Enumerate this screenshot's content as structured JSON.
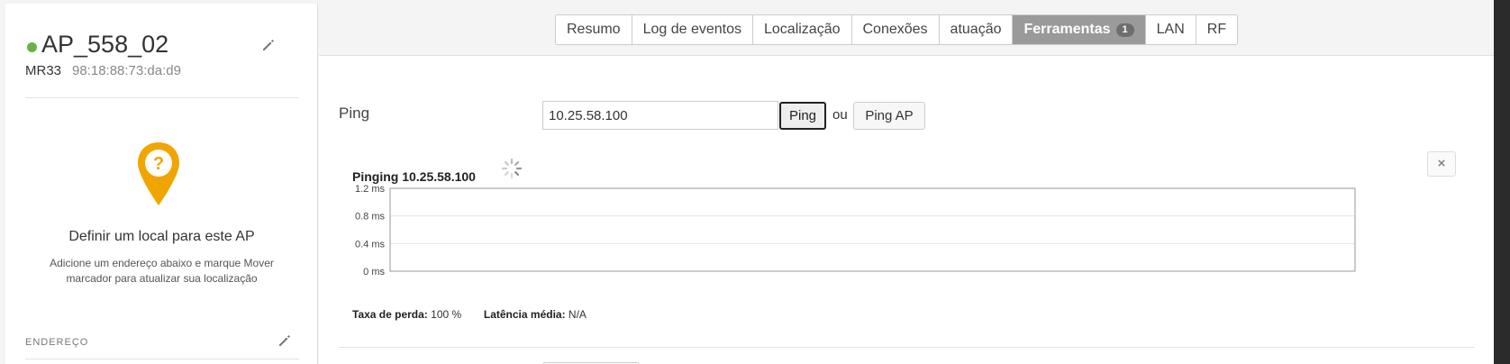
{
  "sidebar": {
    "ap_name": "AP_558_02",
    "status_color": "#67b346",
    "model": "MR33",
    "mac": "98:18:88:73:da:d9",
    "location_title": "Definir um local para este AP",
    "location_subtitle": "Adicione um endereço abaixo e marque Mover marcador para atualizar sua localização",
    "address_label": "ENDEREÇO"
  },
  "tabs": [
    {
      "label": "Resumo"
    },
    {
      "label": "Log de eventos"
    },
    {
      "label": "Localização"
    },
    {
      "label": "Conexões"
    },
    {
      "label": "atuação"
    },
    {
      "label": "Ferramentas",
      "badge": "1",
      "active": true
    },
    {
      "label": "LAN"
    },
    {
      "label": "RF"
    }
  ],
  "ping": {
    "label": "Ping",
    "input_value": "10.25.58.100",
    "ping_button": "Ping",
    "or_text": "ou",
    "ping_ap_button": "Ping AP",
    "close_label": "×",
    "result_title": "Pinging 10.25.58.100"
  },
  "chart_data": {
    "type": "line",
    "title": "",
    "xlabel": "",
    "ylabel": "",
    "y_ticks": [
      "1.2 ms",
      "0.8 ms",
      "0.4 ms",
      "0 ms"
    ],
    "ylim": [
      0,
      1.2
    ],
    "series": [],
    "grid": true
  },
  "stats": {
    "loss_label": "Taxa de perda:",
    "loss_value": "100 %",
    "latency_label": "Latência média:",
    "latency_value": "N/A"
  },
  "colors": {
    "accent_pin": "#f0a500",
    "active_tab": "#9a9a9a"
  }
}
